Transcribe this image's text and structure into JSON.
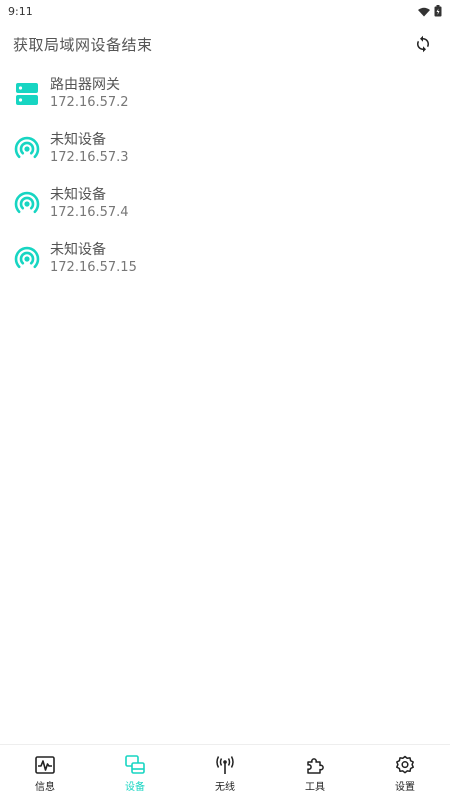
{
  "status_bar": {
    "time": "9:11"
  },
  "header": {
    "title": "获取局域网设备结束"
  },
  "devices": [
    {
      "name": "路由器网关",
      "ip": "172.16.57.2",
      "icon": "router-icon"
    },
    {
      "name": "未知设备",
      "ip": "172.16.57.3",
      "icon": "signal-icon"
    },
    {
      "name": "未知设备",
      "ip": "172.16.57.4",
      "icon": "signal-icon"
    },
    {
      "name": "未知设备",
      "ip": "172.16.57.15",
      "icon": "signal-icon"
    }
  ],
  "nav": [
    {
      "label": "信息",
      "icon": "monitor-icon",
      "active": false
    },
    {
      "label": "设备",
      "icon": "devices-icon",
      "active": true
    },
    {
      "label": "无线",
      "icon": "antenna-icon",
      "active": false
    },
    {
      "label": "工具",
      "icon": "puzzle-icon",
      "active": false
    },
    {
      "label": "设置",
      "icon": "settings-icon",
      "active": false
    }
  ],
  "colors": {
    "accent": "#17d5c2",
    "text": "#555555",
    "subtext": "#777777"
  }
}
